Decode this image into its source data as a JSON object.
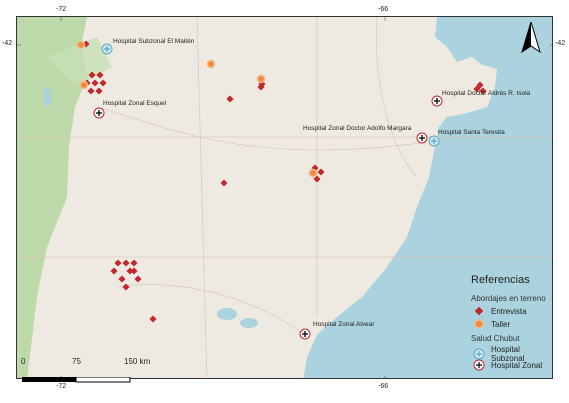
{
  "axes": {
    "top_labels": [
      "-72",
      "-66"
    ],
    "bottom_labels": [
      "-72",
      "-66"
    ],
    "left_labels": [
      "-42"
    ],
    "right_labels": [
      "-42"
    ]
  },
  "colors": {
    "land": "#efeae1",
    "water": "#aad3df",
    "forest": "#b8d7a3",
    "entrevista": "#c0282d",
    "taller": "#f08a3a",
    "subzonal": "#5aa9c4",
    "zonal": "#c0282d"
  },
  "hospitals": [
    {
      "name": "Hospital Subzonal El Maitén",
      "type": "subzonal"
    },
    {
      "name": "Hospital Zonal Esquel",
      "type": "zonal"
    },
    {
      "name": "Hospital Zonal Doctor Adolfo Margara",
      "type": "zonal"
    },
    {
      "name": "Hospital Doctor Aldrés R. Isola",
      "type": "zonal"
    },
    {
      "name": "Hospital Santa Teresita",
      "type": "subzonal"
    },
    {
      "name": "Hospital Zonal Alvear",
      "type": "zonal"
    }
  ],
  "legend": {
    "title": "Referencias",
    "section1": "Abordajes en terreno",
    "item_entrevista": "Entrevista",
    "item_taller": "Taller",
    "section2": "Salud Chubut",
    "item_subzonal": "Hospital Subzonal",
    "item_zonal": "Hospital Zonal"
  },
  "scale": {
    "label_0": "0",
    "label_75": "75",
    "label_150": "150 km"
  },
  "north_icon": "north-arrow-icon"
}
